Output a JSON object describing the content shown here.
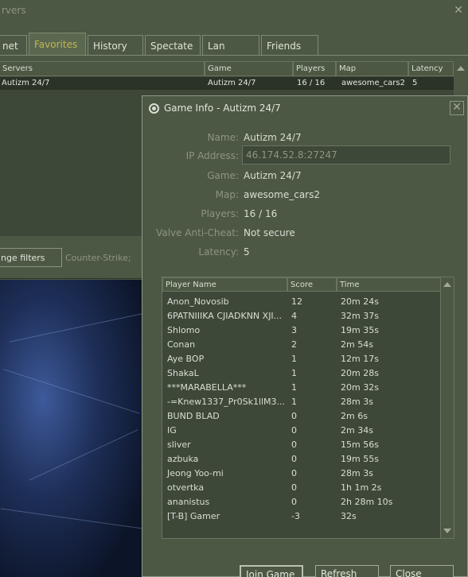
{
  "server_browser": {
    "title": "rvers",
    "tabs": [
      "net",
      "Favorites",
      "History",
      "Spectate",
      "Lan",
      "Friends"
    ],
    "active_tab": "Favorites",
    "columns": [
      "Servers",
      "Game",
      "Players",
      "Map",
      "Latency"
    ],
    "rows": [
      {
        "name": "Autizm 24/7",
        "game": "Autizm 24/7",
        "players": "16 / 16",
        "map": "awesome_cars2",
        "latency": "5"
      }
    ],
    "filters_button": "nge filters",
    "filters_text": "Counter-Strike;"
  },
  "dialog": {
    "title": "Game Info - Autizm 24/7",
    "fields": {
      "name_label": "Name:",
      "name_value": "Autizm 24/7",
      "ip_label": "IP Address:",
      "ip_value": "46.174.52.8:27247",
      "game_label": "Game:",
      "game_value": "Autizm 24/7",
      "map_label": "Map:",
      "map_value": "awesome_cars2",
      "players_label": "Players:",
      "players_value": "16 / 16",
      "vac_label": "Valve Anti-Cheat:",
      "vac_value": "Not secure",
      "latency_label": "Latency:",
      "latency_value": "5"
    },
    "player_columns": [
      "Player Name",
      "Score",
      "Time"
    ],
    "players": [
      {
        "name": "Anon_Novosib",
        "score": "12",
        "time": "20m 24s"
      },
      {
        "name": "6PATNIIIKA CJIADKNN XJI...",
        "score": "4",
        "time": "32m 37s"
      },
      {
        "name": "Shlomo",
        "score": "3",
        "time": "19m 35s"
      },
      {
        "name": "Conan",
        "score": "2",
        "time": "2m 54s"
      },
      {
        "name": "Aye BOP",
        "score": "1",
        "time": "12m 17s"
      },
      {
        "name": "ShakaL",
        "score": "1",
        "time": "20m 28s"
      },
      {
        "name": "***MARABELLA***",
        "score": "1",
        "time": "20m 32s"
      },
      {
        "name": "-=Knew1337_Pr0Sk1llM3...",
        "score": "1",
        "time": "28m 3s"
      },
      {
        "name": "BUND BLAD",
        "score": "0",
        "time": "2m 6s"
      },
      {
        "name": "IG",
        "score": "0",
        "time": "2m 34s"
      },
      {
        "name": "sliver",
        "score": "0",
        "time": "15m 56s"
      },
      {
        "name": "azbuka",
        "score": "0",
        "time": "19m 55s"
      },
      {
        "name": "Jeong Yoo-mi",
        "score": "0",
        "time": "28m 3s"
      },
      {
        "name": "otvertka",
        "score": "0",
        "time": "1h 1m 2s"
      },
      {
        "name": "ananistus",
        "score": "0",
        "time": "2h 28m 10s"
      },
      {
        "name": "[T-B] Gamer",
        "score": "-3",
        "time": "32s"
      }
    ],
    "buttons": {
      "join": "Join Game",
      "refresh": "Refresh",
      "close": "Close"
    }
  },
  "colors": {
    "panel_bg": "#4c5844",
    "list_bg": "#3e4839",
    "selected_row": "#2b3227",
    "active_tab_text": "#c4b550",
    "text": "#d8ded3",
    "label_text": "#8d957f"
  }
}
